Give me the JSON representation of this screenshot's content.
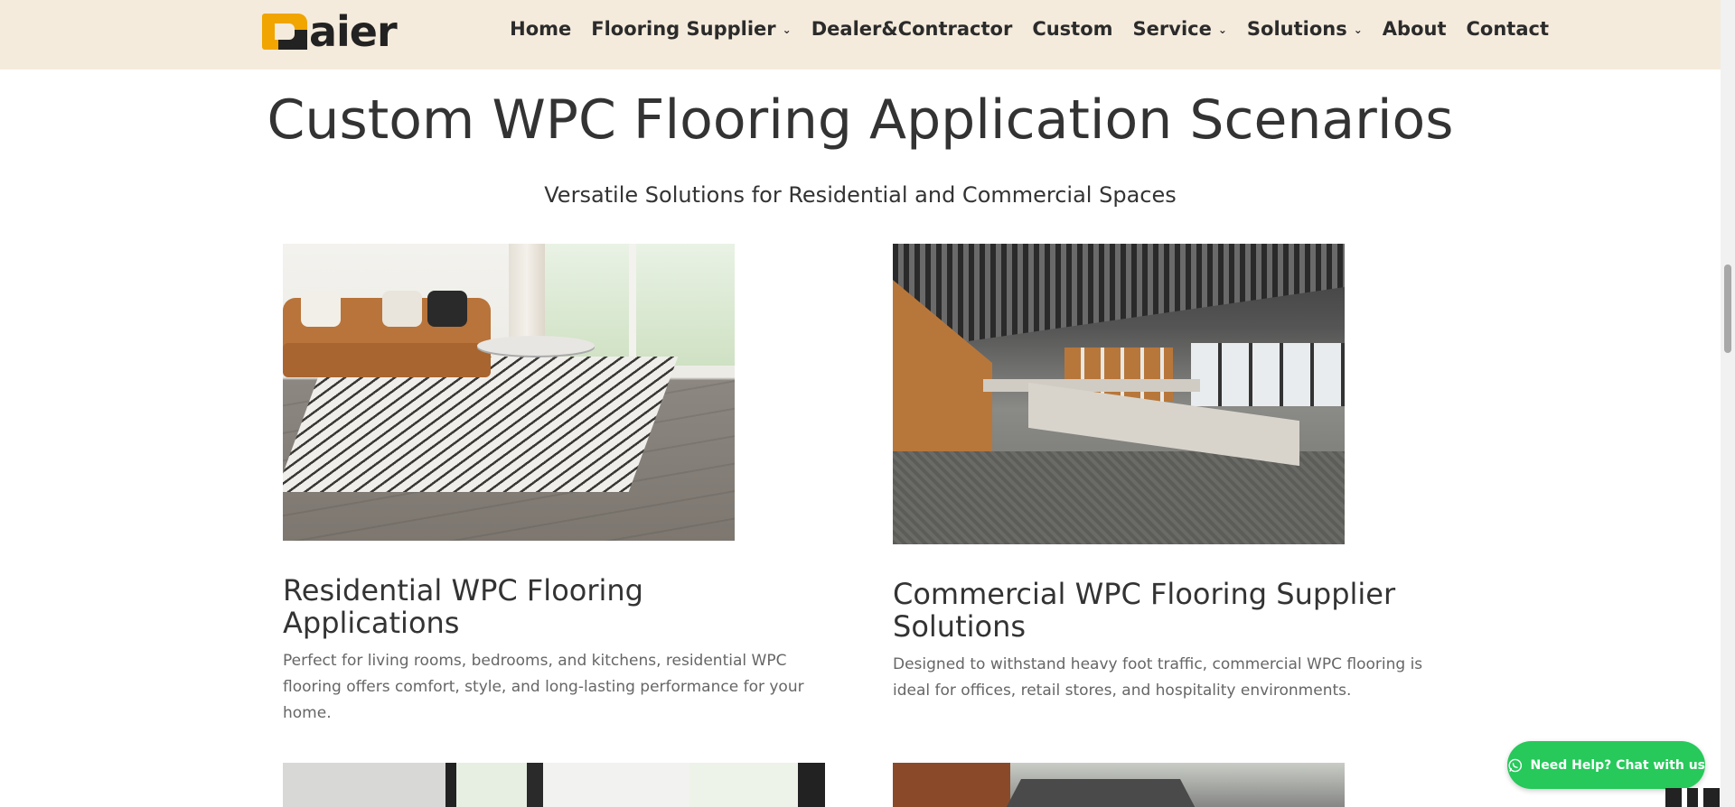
{
  "header": {
    "logo_text": "aier",
    "nav": [
      {
        "label": "Home",
        "has_dropdown": false
      },
      {
        "label": "Flooring Supplier",
        "has_dropdown": true
      },
      {
        "label": "Dealer&Contractor",
        "has_dropdown": false
      },
      {
        "label": "Custom",
        "has_dropdown": false
      },
      {
        "label": "Service",
        "has_dropdown": true
      },
      {
        "label": "Solutions",
        "has_dropdown": true
      },
      {
        "label": "About",
        "has_dropdown": false
      },
      {
        "label": "Contact",
        "has_dropdown": false
      }
    ]
  },
  "main": {
    "title": "Custom WPC Flooring Application Scenarios",
    "subtitle": "Versatile Solutions for Residential and Commercial Spaces",
    "cards": [
      {
        "title": "Residential WPC Flooring Applications",
        "description": "Perfect for living rooms, bedrooms, and kitchens, residential WPC flooring offers comfort, style, and long-lasting performance for your home."
      },
      {
        "title": "Commercial WPC Flooring Supplier Solutions",
        "description": "Designed to withstand heavy foot traffic, commercial WPC flooring is ideal for offices, retail stores, and hospitality environments."
      }
    ]
  },
  "chat": {
    "label": "Need Help? Chat with us"
  },
  "colors": {
    "header_bg": "#f5ebdc",
    "logo_accent": "#f0a500",
    "chat_bg": "#26c95a"
  }
}
